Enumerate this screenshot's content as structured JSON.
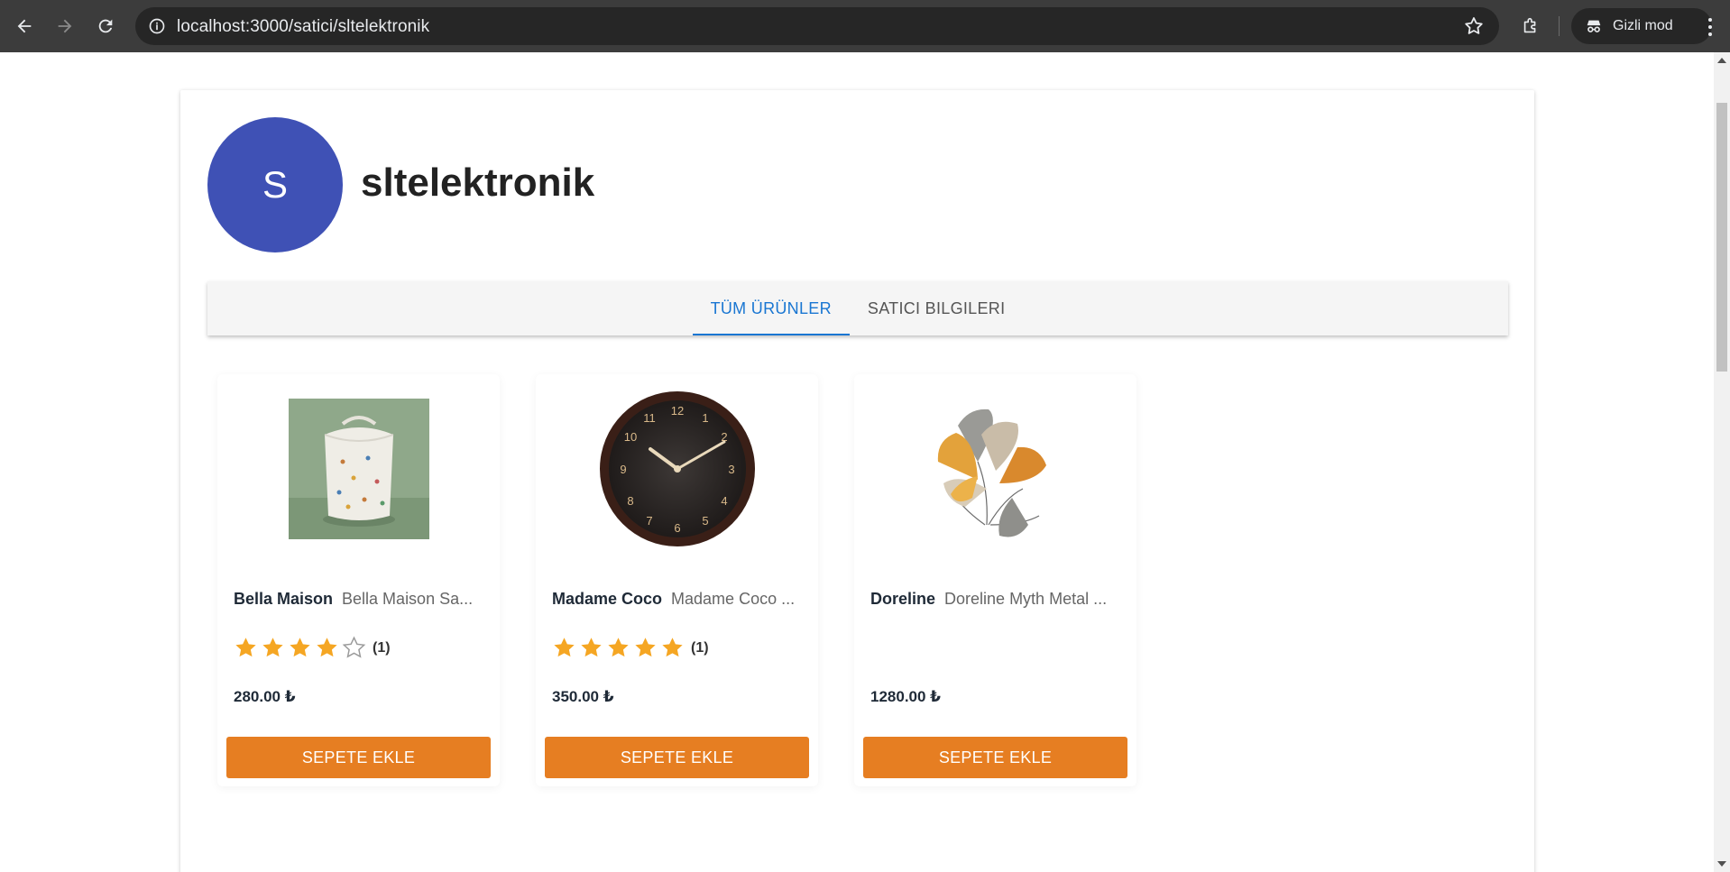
{
  "browser": {
    "url": "localhost:3000/satici/sltelektronik",
    "incognito_label": "Gizli mod"
  },
  "store": {
    "avatar_letter": "S",
    "name": "sltelektronik",
    "avatar_color": "#3f51b5"
  },
  "tabs": [
    {
      "label": "TÜM ÜRÜNLER",
      "active": true
    },
    {
      "label": "SATICI BILGILERI",
      "active": false
    }
  ],
  "products": [
    {
      "brand": "Bella Maison",
      "name": "Bella Maison Sa...",
      "rating": 4,
      "rating_count": "(1)",
      "price": "280.00 ₺",
      "button": "SEPETE EKLE",
      "image": "laundry-basket-image"
    },
    {
      "brand": "Madame Coco",
      "name": "Madame Coco ...",
      "rating": 5,
      "rating_count": "(1)",
      "price": "350.00 ₺",
      "button": "SEPETE EKLE",
      "image": "wall-clock-image"
    },
    {
      "brand": "Doreline",
      "name": "Doreline Myth Metal ...",
      "rating": null,
      "rating_count": "",
      "price": "1280.00 ₺",
      "button": "SEPETE EKLE",
      "image": "metal-wall-art-image"
    }
  ],
  "colors": {
    "accent": "#1976d2",
    "button": "#e67e22",
    "star": "#f5a623"
  }
}
